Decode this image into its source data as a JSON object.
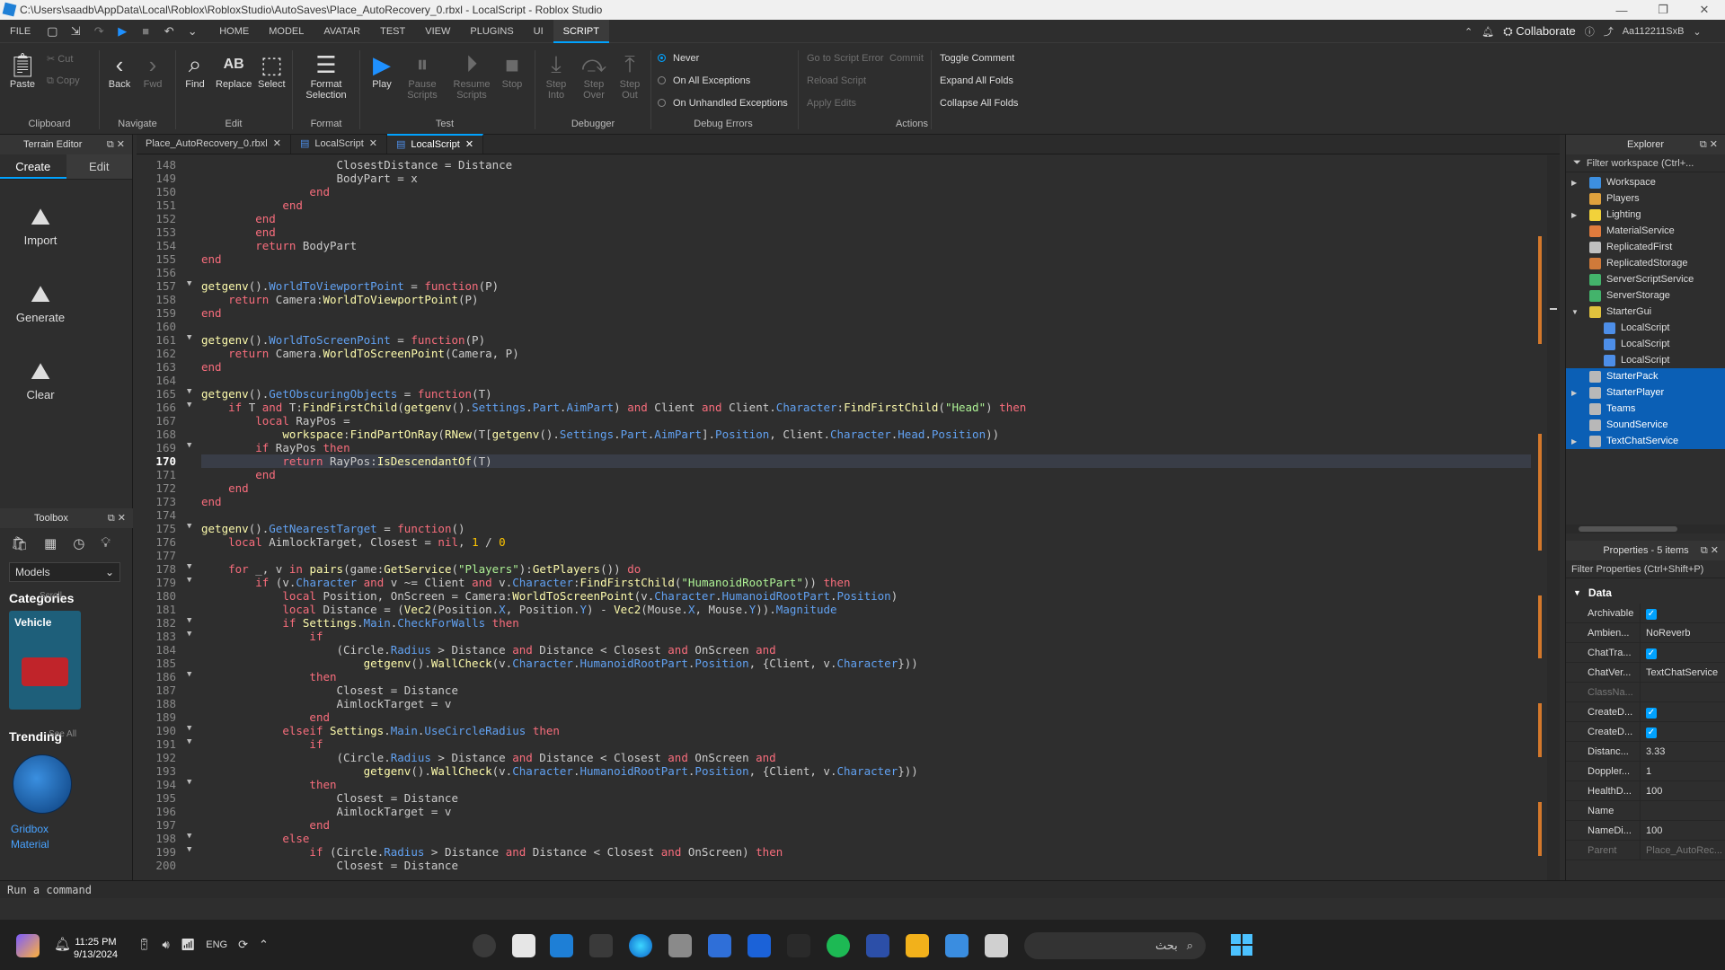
{
  "window": {
    "title": "C:\\Users\\saadb\\AppData\\Local\\Roblox\\RobloxStudio\\AutoSaves\\Place_AutoRecovery_0.rbxl - LocalScript - Roblox Studio",
    "minimize": "—",
    "maximize": "❐",
    "close": "✕"
  },
  "menu": {
    "file": "FILE",
    "tabs": [
      "HOME",
      "MODEL",
      "AVATAR",
      "TEST",
      "VIEW",
      "PLUGINS",
      "UI",
      "SCRIPT"
    ],
    "active": "SCRIPT",
    "collaborate": "Collaborate",
    "user": "Aa112211SxB"
  },
  "ribbon": {
    "paste": "Paste",
    "cut": "Cut",
    "copy": "Copy",
    "clipboard": "Clipboard",
    "back": "Back",
    "fwd": "Fwd",
    "navigate": "Navigate",
    "find": "Find",
    "replace": "Replace",
    "select": "Select",
    "edit": "Edit",
    "format_selection": "Format Selection",
    "format": "Format",
    "play": "Play",
    "pause_scripts": "Pause Scripts",
    "resume_scripts": "Resume Scripts",
    "stop": "Stop",
    "test": "Test",
    "step_into": "Step Into",
    "step_over": "Step Over",
    "step_out": "Step Out",
    "debugger": "Debugger",
    "never": "Never",
    "on_all_exceptions": "On All Exceptions",
    "on_unhandled_exceptions": "On Unhandled Exceptions",
    "debug_errors": "Debug Errors",
    "go_to_script_error": "Go to Script Error",
    "commit": "Commit",
    "reload_script": "Reload Script",
    "apply_edits": "Apply Edits",
    "toggle_comment": "Toggle Comment",
    "expand_all_folds": "Expand All Folds",
    "collapse_all_folds": "Collapse All Folds",
    "actions": "Actions"
  },
  "terrain": {
    "title": "Terrain Editor",
    "tab_create": "Create",
    "tab_edit": "Edit",
    "import": "Import",
    "generate": "Generate",
    "clear": "Clear"
  },
  "toolbox": {
    "title": "Toolbox",
    "dropdown": "Models",
    "categories": "Categories",
    "scroll_hint": "Scroll",
    "vehicle": "Vehicle",
    "trending": "Trending",
    "see_all": "See All",
    "gridbox": "Gridbox",
    "material": "Material"
  },
  "doc_tabs": [
    "Place_AutoRecovery_0.rbxl",
    "LocalScript",
    "LocalScript"
  ],
  "editor": {
    "first_line": 148,
    "current_line": 170,
    "fold_lines": [
      157,
      161,
      165,
      166,
      169,
      175,
      178,
      179,
      182,
      183,
      186,
      190,
      191,
      194,
      198,
      199
    ]
  },
  "explorer": {
    "title": "Explorer",
    "filter": "Filter workspace (Ctrl+...",
    "items": [
      {
        "name": "Workspace",
        "indent": 0,
        "arrow": "▶",
        "color": "#3d8fe0",
        "selected": false
      },
      {
        "name": "Players",
        "indent": 0,
        "arrow": "",
        "color": "#e0a23d",
        "selected": false
      },
      {
        "name": "Lighting",
        "indent": 0,
        "arrow": "▶",
        "color": "#f2d23a",
        "selected": false
      },
      {
        "name": "MaterialService",
        "indent": 0,
        "arrow": "",
        "color": "#e07b3d",
        "selected": false
      },
      {
        "name": "ReplicatedFirst",
        "indent": 0,
        "arrow": "",
        "color": "#c0c0c0",
        "selected": false
      },
      {
        "name": "ReplicatedStorage",
        "indent": 0,
        "arrow": "",
        "color": "#d07a3a",
        "selected": false
      },
      {
        "name": "ServerScriptService",
        "indent": 0,
        "arrow": "",
        "color": "#43b36b",
        "selected": false
      },
      {
        "name": "ServerStorage",
        "indent": 0,
        "arrow": "",
        "color": "#43b36b",
        "selected": false
      },
      {
        "name": "StarterGui",
        "indent": 0,
        "arrow": "▼",
        "color": "#e0c23d",
        "selected": false
      },
      {
        "name": "LocalScript",
        "indent": 1,
        "arrow": "",
        "color": "#4d8ee8",
        "selected": false
      },
      {
        "name": "LocalScript",
        "indent": 1,
        "arrow": "",
        "color": "#4d8ee8",
        "selected": false
      },
      {
        "name": "LocalScript",
        "indent": 1,
        "arrow": "",
        "color": "#4d8ee8",
        "selected": false
      },
      {
        "name": "StarterPack",
        "indent": 0,
        "arrow": "",
        "color": "#b8b8b8",
        "selected": true
      },
      {
        "name": "StarterPlayer",
        "indent": 0,
        "arrow": "▶",
        "color": "#b8b8b8",
        "selected": true
      },
      {
        "name": "Teams",
        "indent": 0,
        "arrow": "",
        "color": "#b8b8b8",
        "selected": true
      },
      {
        "name": "SoundService",
        "indent": 0,
        "arrow": "",
        "color": "#b8b8b8",
        "selected": true
      },
      {
        "name": "TextChatService",
        "indent": 0,
        "arrow": "▶",
        "color": "#b8b8b8",
        "selected": true
      }
    ]
  },
  "properties": {
    "title": "Properties - 5 items",
    "filter": "Filter Properties (Ctrl+Shift+P)",
    "section": "Data",
    "rows": [
      {
        "name": "Archivable",
        "value": "",
        "check": true,
        "dim": false
      },
      {
        "name": "Ambien...",
        "value": "NoReverb",
        "check": false,
        "dim": false
      },
      {
        "name": "ChatTra...",
        "value": "",
        "check": true,
        "dim": false
      },
      {
        "name": "ChatVer...",
        "value": "TextChatService",
        "check": false,
        "dim": false
      },
      {
        "name": "ClassNa...",
        "value": "",
        "check": false,
        "dim": true
      },
      {
        "name": "CreateD...",
        "value": "",
        "check": true,
        "dim": false
      },
      {
        "name": "CreateD...",
        "value": "",
        "check": true,
        "dim": false
      },
      {
        "name": "Distanc...",
        "value": "3.33",
        "check": false,
        "dim": false
      },
      {
        "name": "Doppler...",
        "value": "1",
        "check": false,
        "dim": false
      },
      {
        "name": "HealthD...",
        "value": "100",
        "check": false,
        "dim": false
      },
      {
        "name": "Name",
        "value": "",
        "check": false,
        "dim": false
      },
      {
        "name": "NameDi...",
        "value": "100",
        "check": false,
        "dim": false
      },
      {
        "name": "Parent",
        "value": "Place_AutoRec...",
        "check": false,
        "dim": true
      }
    ]
  },
  "command": {
    "placeholder": "Run a command"
  },
  "taskbar": {
    "time": "11:25 PM",
    "date": "9/13/2024",
    "lang": "ENG",
    "search": "بحث"
  }
}
